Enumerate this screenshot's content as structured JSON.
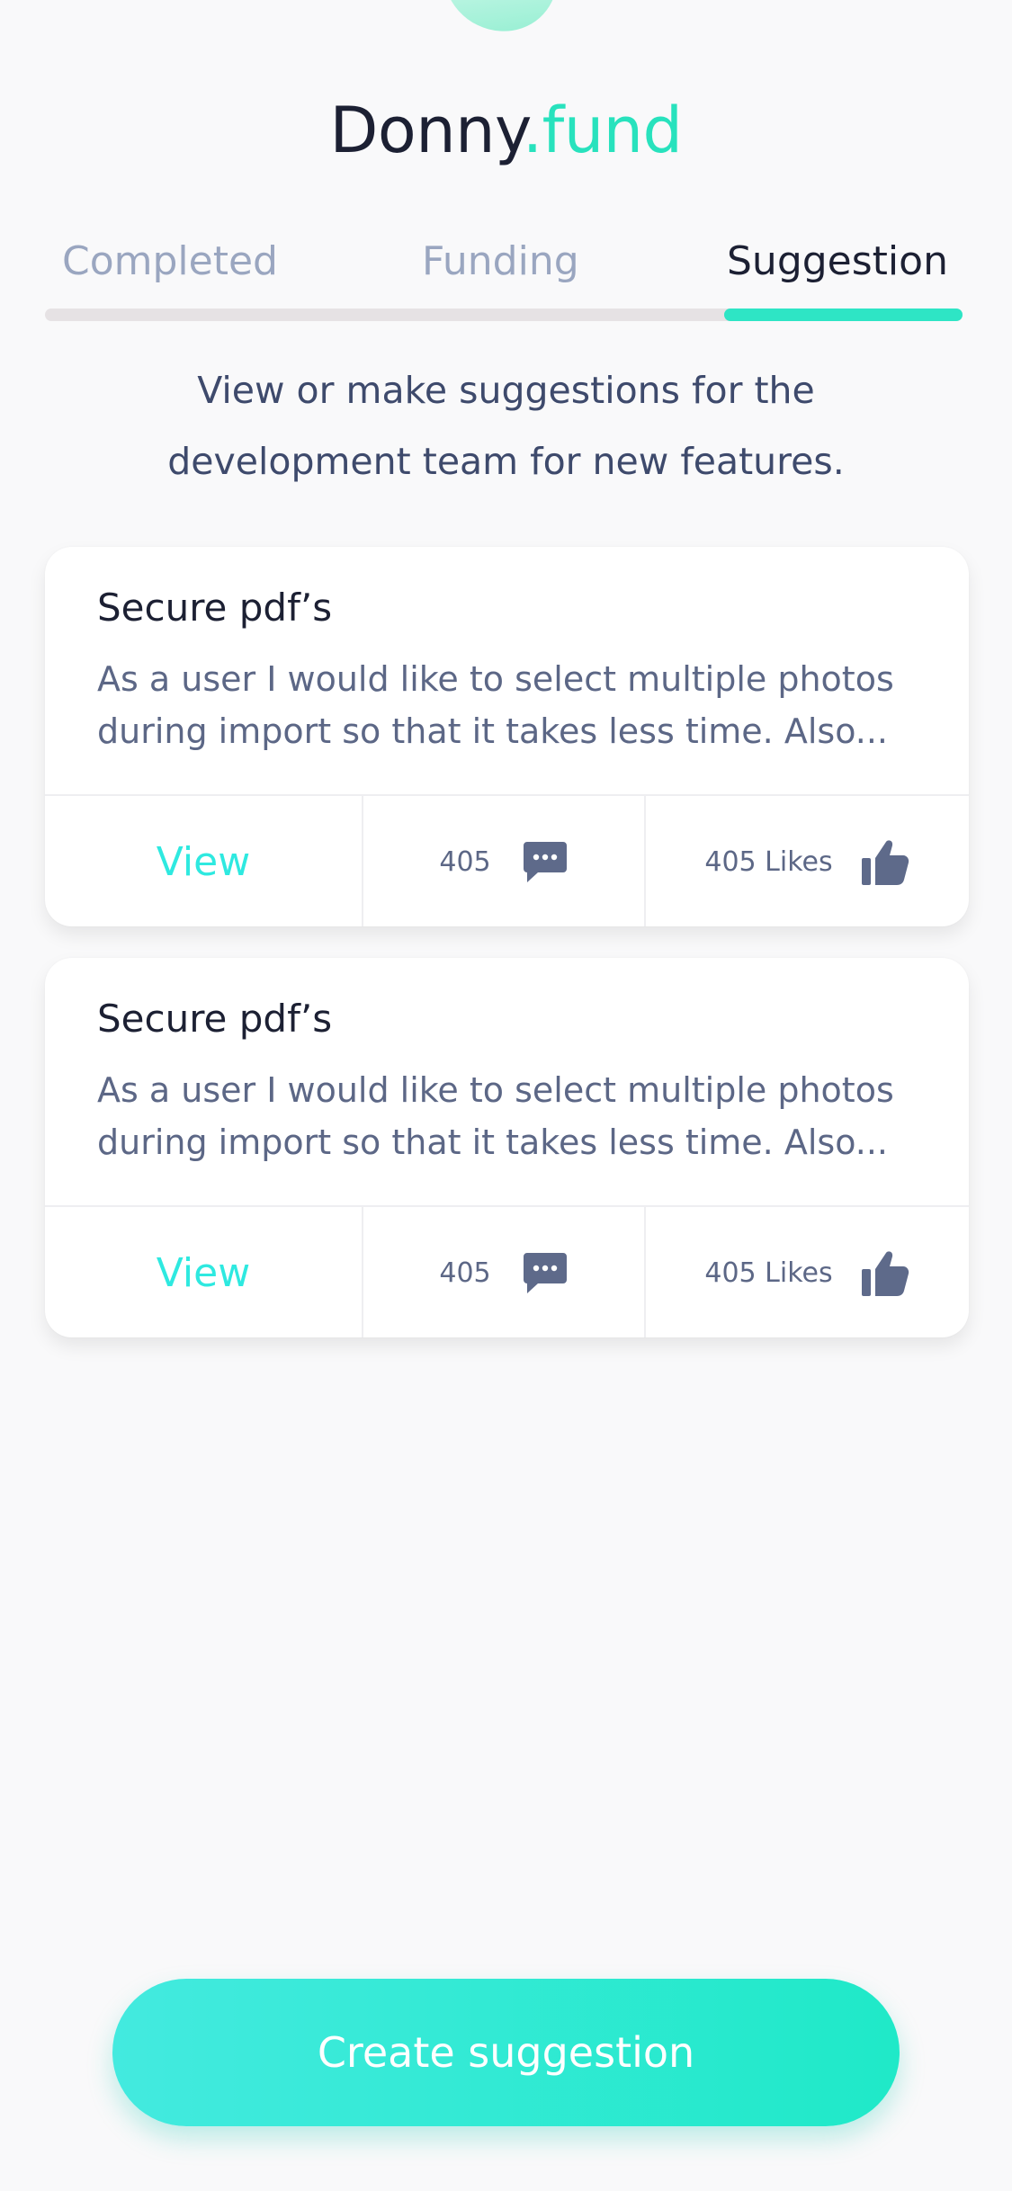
{
  "brand": {
    "name": "Donny",
    "accent": ".fund",
    "accent_color": "#28e2bd"
  },
  "tabs": [
    {
      "label": "Completed",
      "active": false
    },
    {
      "label": "Funding",
      "active": false
    },
    {
      "label": "Suggestion",
      "active": true
    }
  ],
  "intro": {
    "line1": "View or make suggestions for the",
    "line2": "development team for new features."
  },
  "cards": [
    {
      "title": "Secure pdf’s",
      "desc_line1": "As a user I would like to select multiple photos",
      "desc_line2": "during import so that it takes less time. Also...",
      "view_label": "View",
      "comments": "405",
      "comment_icon": "comment-icon",
      "likes": "405 Likes",
      "like_icon": "thumbs-up-icon"
    },
    {
      "title": "Secure pdf’s",
      "desc_line1": "As a user I would like to select multiple photos",
      "desc_line2": "during import so that it takes less time. Also...",
      "view_label": "View",
      "comments": "405",
      "comment_icon": "comment-icon",
      "likes": "405 Likes",
      "like_icon": "thumbs-up-icon"
    }
  ],
  "cta": {
    "label": "Create suggestion"
  },
  "colors": {
    "accent": "#2ee5c5",
    "view_link": "#2ee9e0",
    "icon": "#5e6a8a",
    "inactive_tab": "#9aa6c0"
  }
}
